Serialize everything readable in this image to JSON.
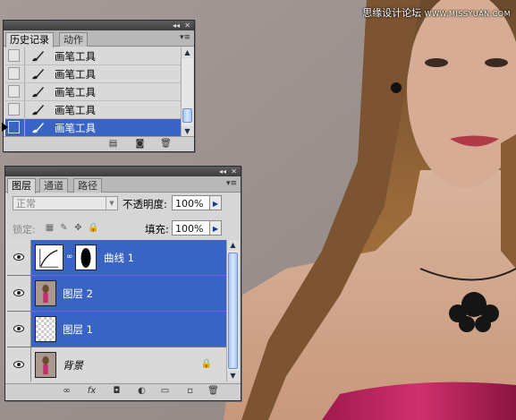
{
  "watermark": {
    "text": "思缘设计论坛",
    "url": "WWW.MISSYUAN.COM"
  },
  "history_panel": {
    "tabs": [
      "历史记录",
      "动作"
    ],
    "items": [
      {
        "label": "画笔工具",
        "selected": false
      },
      {
        "label": "画笔工具",
        "selected": false
      },
      {
        "label": "画笔工具",
        "selected": false
      },
      {
        "label": "画笔工具",
        "selected": false
      },
      {
        "label": "画笔工具",
        "selected": true
      }
    ],
    "footer_icons": [
      "new-document-from-state-icon",
      "camera-snapshot-icon",
      "trash-icon"
    ]
  },
  "layers_panel": {
    "tabs": [
      "图层",
      "通道",
      "路径"
    ],
    "blend_mode": "正常",
    "opacity_label": "不透明度:",
    "opacity_value": "100%",
    "lock_label": "锁定:",
    "fill_label": "填充:",
    "fill_value": "100%",
    "layers": [
      {
        "name": "曲线 1",
        "type": "adjustment-curves",
        "visible": true,
        "selected": true
      },
      {
        "name": "图层 2",
        "type": "image",
        "visible": true,
        "selected": true
      },
      {
        "name": "图层 1",
        "type": "transparent",
        "visible": true,
        "selected": true
      },
      {
        "name": "背景",
        "type": "background",
        "visible": true,
        "selected": false,
        "locked": true
      }
    ],
    "footer_icons": [
      "link-layers-icon",
      "fx-icon",
      "layer-mask-icon",
      "adjustment-layer-icon",
      "group-folder-icon",
      "new-layer-icon",
      "trash-icon"
    ]
  },
  "colors": {
    "selection": "#3a64c4",
    "panel_bg": "#d6d6d6",
    "backdrop": "#9c928f"
  }
}
